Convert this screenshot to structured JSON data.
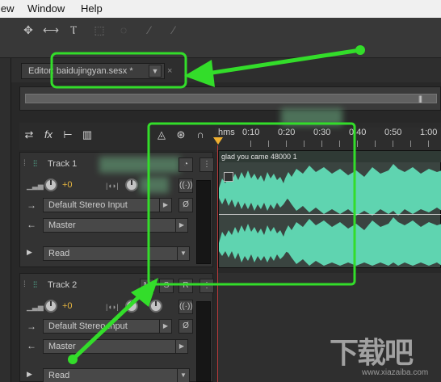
{
  "menu": {
    "items": [
      "iew",
      "Window",
      "Help"
    ]
  },
  "toolbar": {
    "icons": [
      "move-tool-icon",
      "time-selection-icon",
      "razor-icon",
      "marquee-icon",
      "lasso-icon",
      "brush-icon",
      "healing-icon"
    ]
  },
  "editor_tab": {
    "label": "Editor: baidujingyan.sesx *",
    "close": "×"
  },
  "header_buttons": {
    "icons": [
      "switch-icon",
      "fx-icon",
      "sends-icon",
      "eq-icon",
      "metronome-icon",
      "snap-icon",
      "headphones-icon"
    ]
  },
  "ruler": {
    "labels": [
      "hms",
      "0:10",
      "0:20",
      "0:30",
      "0:40",
      "0:50",
      "1:00"
    ]
  },
  "tracks": [
    {
      "name": "Track 1",
      "volume": "+0",
      "input": "Default Stereo Input",
      "output": "Master",
      "automation": "Read",
      "clip_title": "glad you came 48000 1"
    },
    {
      "name": "Track 2",
      "volume": "+0",
      "input": "Default Stereo Input",
      "output": "Master",
      "automation": "Read"
    }
  ],
  "colors": {
    "waveform": "#5fd4b0",
    "annotation": "#33dd2a",
    "playhead": "#f0b030",
    "volume_value": "#e7b640"
  },
  "watermark": {
    "text": "下载吧",
    "sub": "www.xiazaiba.com"
  }
}
